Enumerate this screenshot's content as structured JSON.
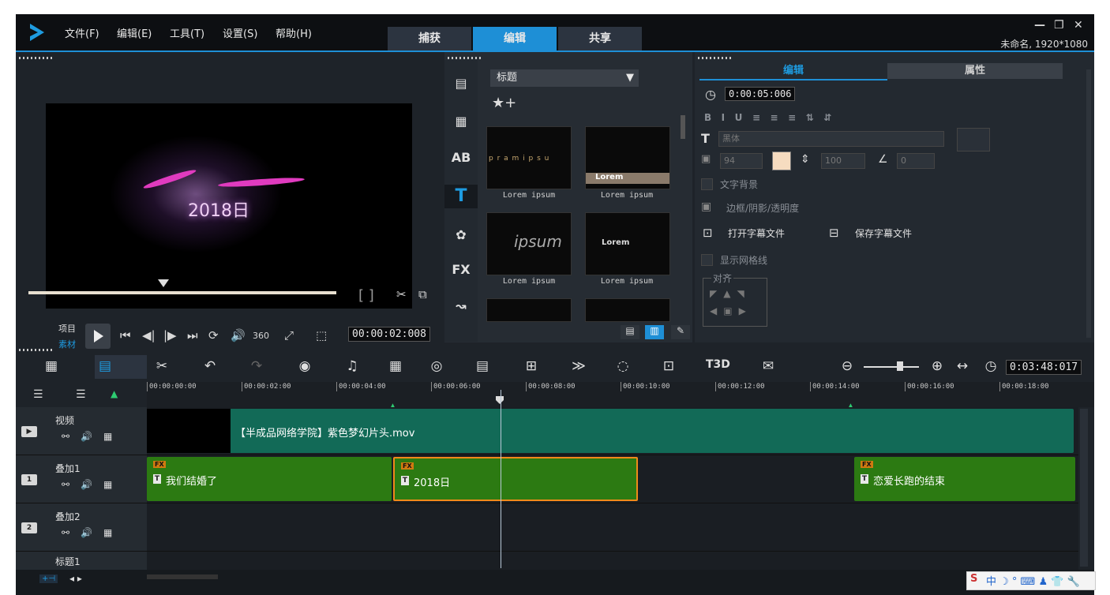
{
  "menu": {
    "file": "文件(F)",
    "edit": "编辑(E)",
    "tools": "工具(T)",
    "settings": "设置(S)",
    "help": "帮助(H)"
  },
  "modes": {
    "capture": "捕获",
    "edit": "编辑",
    "share": "共享"
  },
  "project_info": "未命名, 1920*1080",
  "preview": {
    "title_text": "2018日",
    "mode_project": "项目",
    "mode_clip": "素材",
    "timecode": "00:00:02:008",
    "brackets": "[ ]",
    "label_360": "360"
  },
  "library": {
    "category": "标题",
    "fx_label": "FX",
    "thumbnails": [
      {
        "label": "Lorem ipsum",
        "preview_text": "p r a m   i p s u"
      },
      {
        "label": "Lorem ipsum",
        "preview_text": "Lorem"
      },
      {
        "label": "Lorem ipsum",
        "preview_text": "ipsum"
      },
      {
        "label": "Lorem ipsum",
        "preview_text": "Lorem"
      }
    ]
  },
  "options": {
    "tab_edit": "编辑",
    "tab_props": "属性",
    "duration": "0:00:05:006",
    "font": "黑体",
    "size": "94",
    "line_spacing": "100",
    "angle": "0",
    "text_bg": "文字背景",
    "border_shadow": "边框/阴影/透明度",
    "open_subtitle": "打开字幕文件",
    "save_subtitle": "保存字幕文件",
    "show_grid": "显示网格线",
    "align": "对齐"
  },
  "timeline": {
    "total_time": "0:03:48:017",
    "ruler": [
      "00:00:00:00",
      "00:00:02:00",
      "00:00:04:00",
      "00:00:06:00",
      "00:00:08:00",
      "00:00:10:00",
      "00:00:12:00",
      "00:00:14:00",
      "00:00:16:00",
      "00:00:18:00"
    ],
    "tracks": {
      "video": "视频",
      "overlay1": "叠加1",
      "overlay2": "叠加2",
      "title1": "标题1"
    },
    "clips": {
      "video_clip": "【半成品网络学院】紫色梦幻片头.mov",
      "overlay_a": "我们结婚了",
      "overlay_b": "2018日",
      "overlay_c": "恋爱长跑的结束",
      "fx": "FX",
      "t": "T"
    }
  },
  "colors": {
    "accent": "#1e8fd6",
    "video_clip": "#126a57",
    "overlay_clip": "#2c7a12",
    "selected_border": "#f08a1a"
  }
}
